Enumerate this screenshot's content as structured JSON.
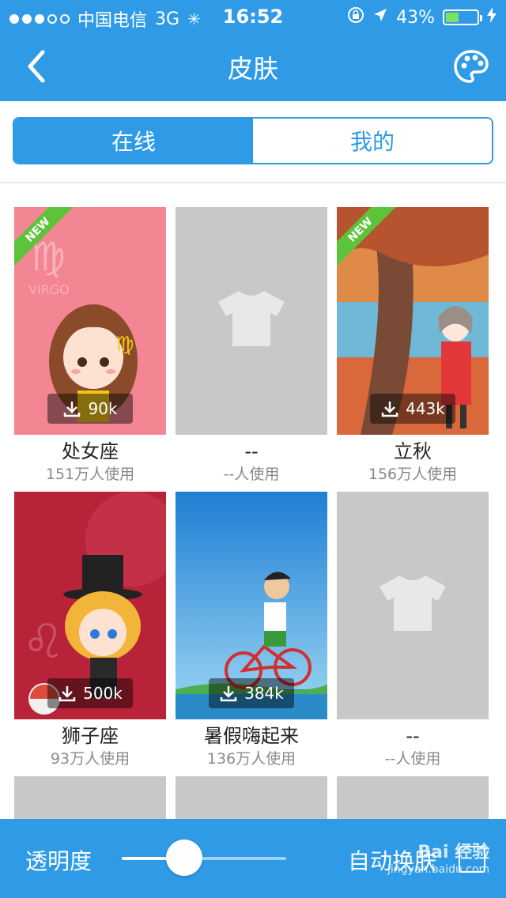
{
  "status_bar": {
    "carrier": "中国电信",
    "network": "3G",
    "time": "16:52",
    "battery": "43%",
    "battery_level": 0.43
  },
  "nav": {
    "title": "皮肤"
  },
  "tabs": [
    {
      "label": "在线",
      "active": true
    },
    {
      "label": "我的",
      "active": false
    }
  ],
  "skins": [
    {
      "title": "处女座",
      "users": "151万人使用",
      "downloads": "90k",
      "is_new": true,
      "art": "virgo"
    },
    {
      "title": "--",
      "users": "--人使用",
      "downloads": "",
      "is_new": false,
      "art": "placeholder"
    },
    {
      "title": "立秋",
      "users": "156万人使用",
      "downloads": "443k",
      "is_new": true,
      "art": "autumn"
    },
    {
      "title": "狮子座",
      "users": "93万人使用",
      "downloads": "500k",
      "is_new": false,
      "art": "leo"
    },
    {
      "title": "暑假嗨起来",
      "users": "136万人使用",
      "downloads": "384k",
      "is_new": false,
      "art": "summer"
    },
    {
      "title": "--",
      "users": "--人使用",
      "downloads": "",
      "is_new": false,
      "art": "placeholder"
    }
  ],
  "badge_label": "NEW",
  "bottom_bar": {
    "opacity_label": "透明度",
    "opacity_value": 0.38,
    "auto_switch_label": "自动换肤"
  },
  "watermark": {
    "brand": "Bai 经验",
    "url": "jingyan.baidu.com"
  }
}
